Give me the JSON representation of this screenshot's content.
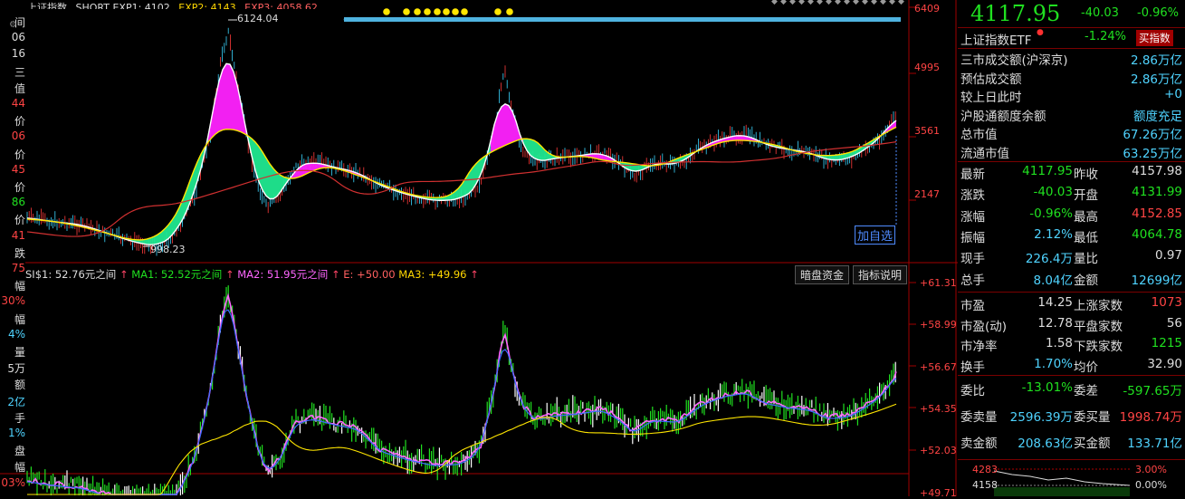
{
  "header": {
    "title": "上证指数",
    "indicator_text": "SHORT EXP1: 4102",
    "exp2_text": "EXP2: 4143",
    "exp3_text": "EXP3: 4058.62"
  },
  "left_labels": [
    "间",
    "06",
    "16",
    "三",
    "值",
    "44",
    "价",
    "06",
    "价",
    "45",
    "价",
    "86",
    "价",
    "41",
    "跌",
    "75",
    "幅",
    "30%",
    "幅",
    "4%",
    "量",
    "5万",
    "额",
    "2亿",
    "手",
    "1%",
    "盘",
    "幅",
    "03%"
  ],
  "chart_main": {
    "high_label": "6124.04",
    "low_label": "998.23",
    "axis": [
      "6409",
      "4995",
      "3561",
      "2147"
    ],
    "add_watch": "加自选"
  },
  "chart_sub": {
    "indicator_line": {
      "si": "SI$1: 52.76元之间",
      "ma1": "MA1: 52.52元之间",
      "ma2": "MA2: 51.95元之间",
      "e": "E: +50.00",
      "ma3": "MA3: +49.96"
    },
    "buttons": [
      "暗盘资金",
      "指标说明"
    ],
    "axis": [
      "+61.31",
      "+58.99",
      "+56.67",
      "+54.35",
      "+52.03",
      "+49.71"
    ]
  },
  "quote": {
    "price": "4117.95",
    "change": "-40.03",
    "pct": "-0.96%",
    "etf_name": "上证指数ETF",
    "etf_pct": "-1.24%",
    "buy_btn": "买指数"
  },
  "market": [
    {
      "label": "三市成交额(沪深京)",
      "value": "2.86万亿"
    },
    {
      "label": "预估成交额",
      "value": "2.86万亿"
    },
    {
      "label": "较上日此时",
      "value": "+0"
    },
    {
      "label": "沪股通额度余额",
      "value": "额度充足"
    },
    {
      "label": "总市值",
      "value": "67.26万亿"
    },
    {
      "label": "流通市值",
      "value": "63.25万亿"
    }
  ],
  "stats": [
    {
      "l1": "最新",
      "v1": "4117.95",
      "l2": "昨收",
      "v2": "4157.98"
    },
    {
      "l1": "涨跌",
      "v1": "-40.03",
      "l2": "开盘",
      "v2": "4131.99"
    },
    {
      "l1": "涨幅",
      "v1": "-0.96%",
      "l2": "最高",
      "v2": "4152.85"
    },
    {
      "l1": "振幅",
      "v1": "2.12%",
      "l2": "最低",
      "v2": "4064.78"
    },
    {
      "l1": "现手",
      "v1": "226.4万",
      "l2": "量比",
      "v2": "0.97"
    },
    {
      "l1": "总手",
      "v1": "8.04亿",
      "l2": "金额",
      "v2": "12699亿"
    }
  ],
  "breadth": [
    {
      "l1": "市盈",
      "v1": "14.25",
      "l2": "上涨家数",
      "v2": "1073"
    },
    {
      "l1": "市盈(动)",
      "v1": "12.78",
      "l2": "平盘家数",
      "v2": "56"
    },
    {
      "l1": "市净率",
      "v1": "1.58",
      "l2": "下跌家数",
      "v2": "1215"
    },
    {
      "l1": "换手",
      "v1": "1.70%",
      "l2": "均价",
      "v2": "32.90"
    }
  ],
  "orders": [
    {
      "l1": "委比",
      "v1": "-13.01%",
      "l2": "委差",
      "v2": "-597.65万"
    },
    {
      "l1": "委卖量",
      "v1": "2596.39万",
      "l2": "委买量",
      "v2": "1998.74万"
    },
    {
      "l1": "卖金额",
      "v1": "208.63亿",
      "l2": "买金额",
      "v2": "133.71亿"
    }
  ],
  "mini": {
    "p1": "4283",
    "p2": "4158",
    "pct1": "3.00%",
    "pct2": "0.00%"
  }
}
